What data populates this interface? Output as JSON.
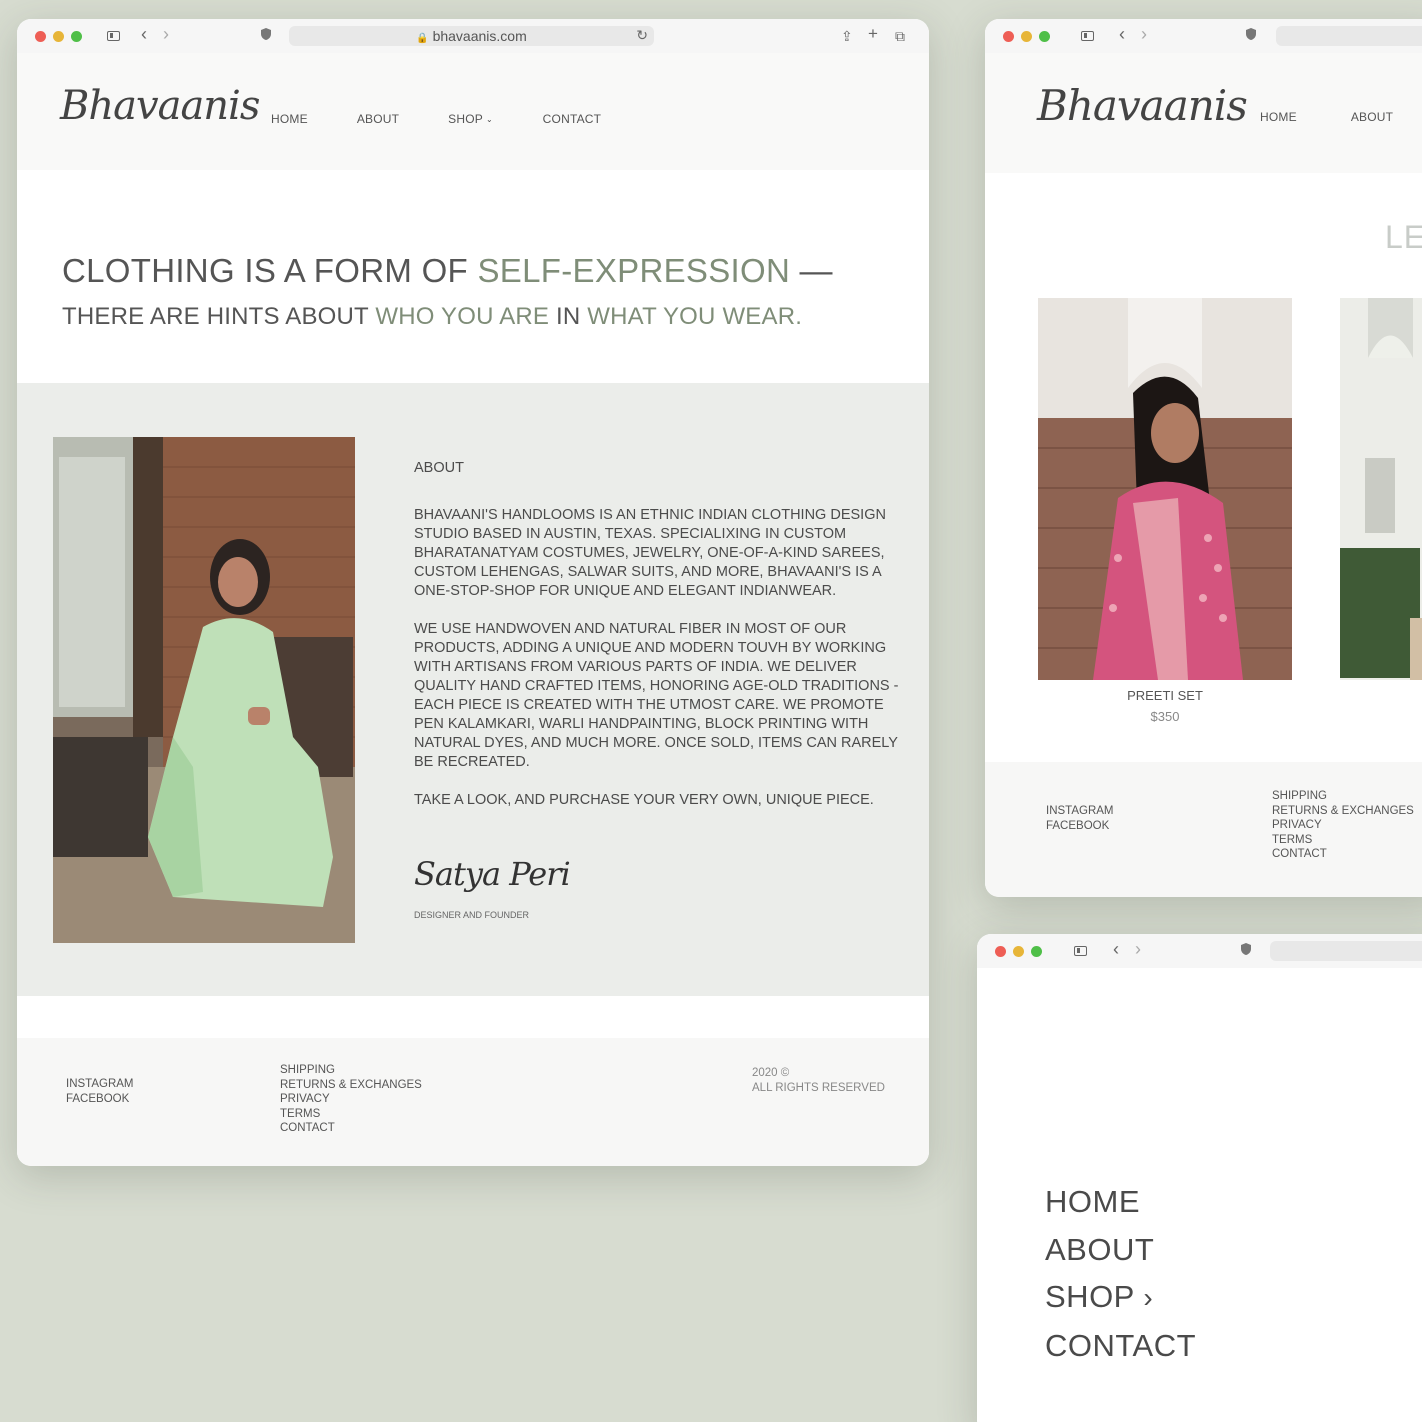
{
  "main_window": {
    "url": "bhavaanis.com",
    "logo": "Bhavaanis",
    "nav": [
      "HOME",
      "ABOUT",
      "SHOP",
      "CONTACT"
    ],
    "hero": {
      "line1_a": "CLOTHING IS A FORM OF ",
      "line1_b": "SELF-EXPRESSION",
      "line1_c": " —",
      "line2_a": "THERE ARE HINTS ABOUT ",
      "line2_b": "WHO YOU ARE",
      "line2_c": " IN ",
      "line2_d": "WHAT YOU WEAR."
    },
    "about": {
      "heading": "ABOUT",
      "p1": "BHAVAANI'S HANDLOOMS IS AN ETHNIC INDIAN CLOTHING DESIGN STUDIO BASED IN AUSTIN, TEXAS. SPECIALIXING IN CUSTOM BHARATANATYAM COSTUMES, JEWELRY, ONE-OF-A-KIND SAREES, CUSTOM LEHENGAS, SALWAR SUITS, AND MORE, BHAVAANI'S IS A ONE-STOP-SHOP FOR UNIQUE AND ELEGANT INDIANWEAR.",
      "p2": "WE USE HANDWOVEN AND NATURAL FIBER IN MOST OF OUR PRODUCTS, ADDING A UNIQUE AND MODERN TOUVH BY WORKING WITH ARTISANS FROM VARIOUS PARTS OF INDIA. WE DELIVER QUALITY HAND CRAFTED ITEMS, HONORING AGE-OLD TRADITIONS - EACH PIECE IS CREATED WITH THE UTMOST CARE. WE PROMOTE PEN KALAMKARI, WARLI HANDPAINTING, BLOCK PRINTING WITH NATURAL DYES, AND MUCH MORE. ONCE SOLD, ITEMS CAN RARELY BE RECREATED.",
      "p3": "TAKE A LOOK, AND PURCHASE YOUR VERY OWN, UNIQUE PIECE.",
      "signature": "Satya Peri",
      "role": "DESIGNER AND FOUNDER"
    },
    "footer": {
      "social": [
        "INSTAGRAM",
        "FACEBOOK"
      ],
      "links": [
        "SHIPPING",
        "RETURNS & EXCHANGES",
        "PRIVACY",
        "TERMS",
        "CONTACT"
      ],
      "copyright": [
        "2020 ©",
        "ALL RIGHTS RESERVED"
      ]
    }
  },
  "shop_window": {
    "logo": "Bhavaanis",
    "nav": [
      "HOME",
      "ABOUT"
    ],
    "section_partial": "LE",
    "product": {
      "name": "PREETI SET",
      "price": "$350"
    },
    "footer": {
      "social": [
        "INSTAGRAM",
        "FACEBOOK"
      ],
      "links": [
        "SHIPPING",
        "RETURNS & EXCHANGES",
        "PRIVACY",
        "TERMS",
        "CONTACT"
      ]
    }
  },
  "menu_window": {
    "items": [
      "HOME",
      "ABOUT",
      "SHOP",
      "CONTACT"
    ]
  },
  "colors": {
    "background": "#d7dcd0",
    "accent": "#7f8d78",
    "section": "#ebedea"
  }
}
